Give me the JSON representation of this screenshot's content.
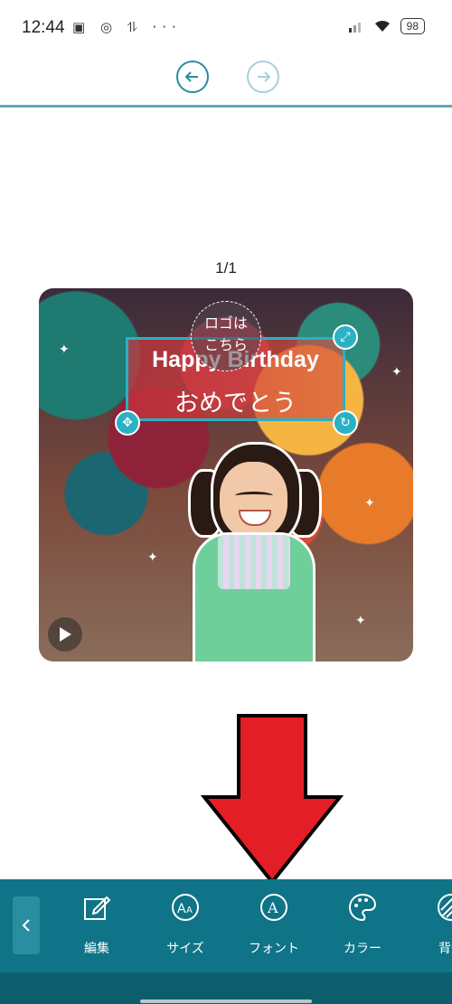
{
  "status_bar": {
    "time": "12:44",
    "left_icons": "▣ ◎ ⥮ ···",
    "battery": "98"
  },
  "toolbar_top": {
    "undo_icon": "undo-icon",
    "redo_icon": "redo-icon"
  },
  "page_indicator": "1/1",
  "canvas": {
    "title_line1": "Happy Birthday",
    "title_line2": "おめでとう",
    "logo_placeholder": "ロゴは\nこちら"
  },
  "bottom_toolbar": {
    "items": [
      {
        "label": "編集",
        "icon": "edit-icon"
      },
      {
        "label": "サイズ",
        "icon": "text-size-icon"
      },
      {
        "label": "フォント",
        "icon": "font-icon"
      },
      {
        "label": "カラー",
        "icon": "palette-icon"
      },
      {
        "label": "背景",
        "icon": "background-icon"
      }
    ]
  },
  "colors": {
    "accent": "#0f7487",
    "selection": "#2ab1c4",
    "arrow": "#e41e26"
  }
}
